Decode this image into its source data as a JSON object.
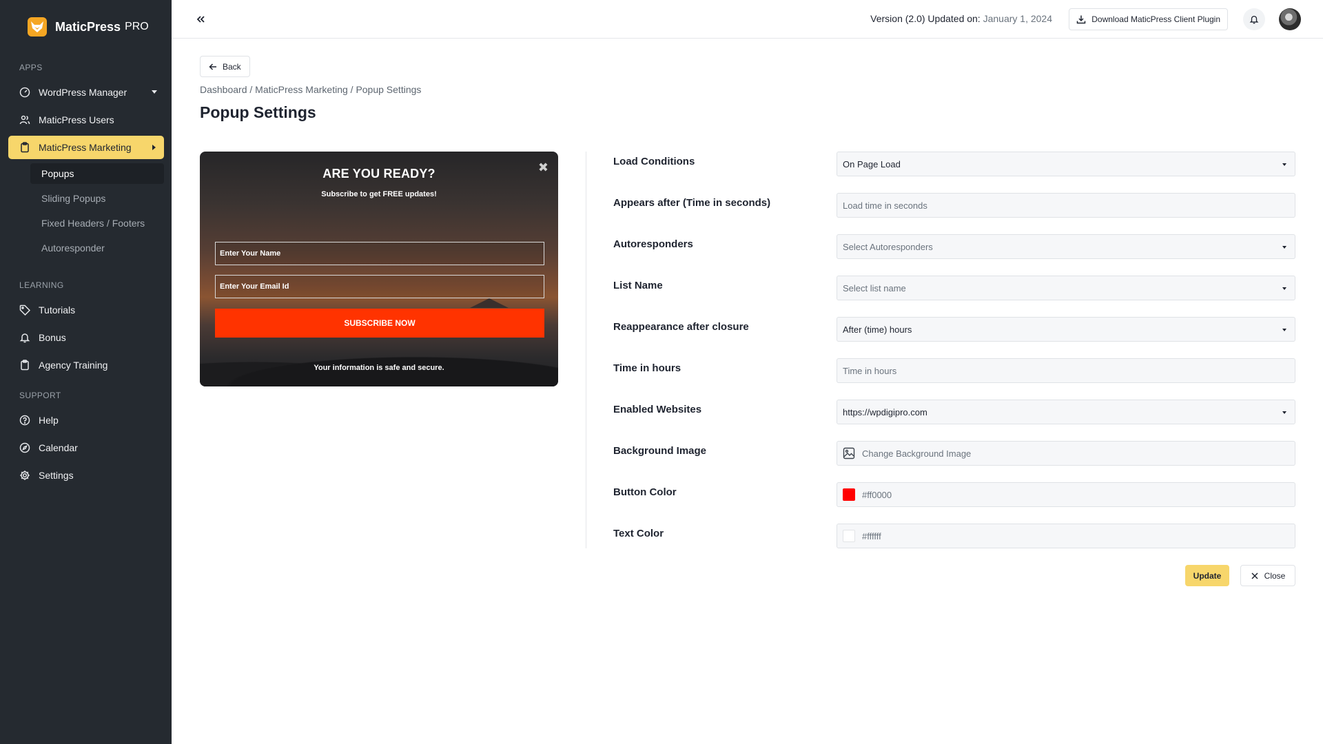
{
  "brand": {
    "name": "MaticPress",
    "suffix": "PRO",
    "logo_icon": "fox-logo-icon"
  },
  "sidebar": {
    "sections": {
      "apps": "APPS",
      "learning": "LEARNING",
      "support": "SUPPORT"
    },
    "apps": [
      {
        "label": "WordPress Manager",
        "icon": "dashboard-gauge-icon"
      },
      {
        "label": "MaticPress Users",
        "icon": "users-icon"
      },
      {
        "label": "MaticPress Marketing",
        "icon": "clipboard-icon"
      }
    ],
    "marketing_sub": [
      "Popups",
      "Sliding Popups",
      "Fixed Headers / Footers",
      "Autoresponder"
    ],
    "learning": [
      {
        "label": "Tutorials",
        "icon": "tag-icon"
      },
      {
        "label": "Bonus",
        "icon": "bell-icon"
      },
      {
        "label": "Agency Training",
        "icon": "clipboard-icon"
      }
    ],
    "support": [
      {
        "label": "Help",
        "icon": "help-circle-icon"
      },
      {
        "label": "Calendar",
        "icon": "compass-icon"
      },
      {
        "label": "Settings",
        "icon": "gear-icon"
      }
    ]
  },
  "topbar": {
    "version_label": "Version (2.0) Updated on:",
    "version_date": "January 1, 2024",
    "download_label": "Download MaticPress Client Plugin"
  },
  "main": {
    "back_label": "Back",
    "breadcrumb": [
      "Dashboard",
      "MaticPress Marketing",
      "Popup Settings"
    ],
    "breadcrumb_sep": " / ",
    "title": "Popup Settings"
  },
  "preview": {
    "title": "ARE YOU READY?",
    "subtitle": "Subscribe to get FREE updates!",
    "name_placeholder": "Enter Your Name",
    "email_placeholder": "Enter Your Email Id",
    "button": "SUBSCRIBE NOW",
    "footer": "Your information is safe and secure.",
    "close_glyph": "✖"
  },
  "form": {
    "load_conditions": {
      "label": "Load Conditions",
      "value": "On Page Load"
    },
    "appears_after": {
      "label": "Appears after (Time in seconds)",
      "placeholder": "Load time in seconds"
    },
    "autoresponders": {
      "label": "Autoresponders",
      "placeholder": "Select Autoresponders"
    },
    "list_name": {
      "label": "List Name",
      "placeholder": "Select list name"
    },
    "reappearance": {
      "label": "Reappearance after closure",
      "value": "After (time) hours"
    },
    "time_hours": {
      "label": "Time in hours",
      "placeholder": "Time in hours"
    },
    "enabled_websites": {
      "label": "Enabled Websites",
      "value": "https://wpdigipro.com"
    },
    "background_image": {
      "label": "Background Image",
      "value": "Change Background Image"
    },
    "button_color": {
      "label": "Button Color",
      "value": "#ff0000"
    },
    "text_color": {
      "label": "Text Color",
      "value": "#ffffff"
    }
  },
  "actions": {
    "update": "Update",
    "close": "Close"
  },
  "colors": {
    "sidebar_bg": "#252a30",
    "accent": "#f7d66b",
    "cta": "#ff3300"
  }
}
